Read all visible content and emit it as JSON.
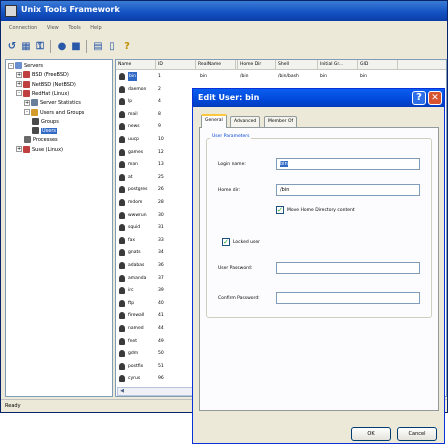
{
  "window": {
    "title": "Unix Tools Framework"
  },
  "menu": [
    "Connection",
    "View",
    "Tools",
    "Help"
  ],
  "tree": [
    {
      "label": "Servers",
      "indent": 0,
      "exp": "-",
      "color": "#6a8fd0"
    },
    {
      "label": "BSD (FreeBSD)",
      "indent": 1,
      "exp": "+",
      "color": "#c04040"
    },
    {
      "label": "NetBSD (NetBSD)",
      "indent": 1,
      "exp": "+",
      "color": "#c04040"
    },
    {
      "label": "RedHat (Linux)",
      "indent": 1,
      "exp": "-",
      "color": "#c04040"
    },
    {
      "label": "Server Statistics",
      "indent": 2,
      "exp": "+",
      "color": "#6a7f99"
    },
    {
      "label": "Users and Groups",
      "indent": 2,
      "exp": "-",
      "color": "#d59b2a"
    },
    {
      "label": "Groups",
      "indent": 3,
      "exp": "",
      "color": "#4a4a4a"
    },
    {
      "label": "Users",
      "indent": 3,
      "exp": "",
      "color": "#4a4a4a",
      "selected": true
    },
    {
      "label": "Processes",
      "indent": 2,
      "exp": "",
      "color": "#6a6a6a"
    },
    {
      "label": "Suse (Linux)",
      "indent": 1,
      "exp": "+",
      "color": "#c04040"
    }
  ],
  "columns": [
    "Name",
    "ID",
    "",
    "RealName",
    "Home Dir",
    "Shell",
    "Initial Gr...",
    "GID"
  ],
  "first_row": {
    "name": "bin",
    "id": "1",
    "realname": "bin",
    "home": "/bin",
    "shell": "/bin/bash",
    "group": "bin",
    "gid": "bin"
  },
  "users": [
    [
      "bin",
      "1"
    ],
    [
      "daemon",
      "2"
    ],
    [
      "lp",
      "4"
    ],
    [
      "mail",
      "8"
    ],
    [
      "news",
      "9"
    ],
    [
      "uucp",
      "10"
    ],
    [
      "games",
      "12"
    ],
    [
      "man",
      "13"
    ],
    [
      "at",
      "25"
    ],
    [
      "postgres",
      "26"
    ],
    [
      "mdom",
      "28"
    ],
    [
      "wwwrun",
      "30"
    ],
    [
      "squid",
      "31"
    ],
    [
      "fax",
      "33"
    ],
    [
      "gnats",
      "34"
    ],
    [
      "adabas",
      "36"
    ],
    [
      "amanda",
      "37"
    ],
    [
      "irc",
      "39"
    ],
    [
      "ftp",
      "40"
    ],
    [
      "firewall",
      "41"
    ],
    [
      "named",
      "44"
    ],
    [
      "fnet",
      "49"
    ],
    [
      "gdm",
      "50"
    ],
    [
      "postfix",
      "51"
    ],
    [
      "cyrus",
      "96"
    ]
  ],
  "status": "Ready",
  "dialog": {
    "title": "Edit User: bin",
    "tabs": [
      "General",
      "Advanced",
      "Member Of"
    ],
    "group_label": "User Parameters",
    "login_label": "Login name:",
    "login_value": "bin",
    "home_label": "Home dir:",
    "home_value": "/bin",
    "move_home_label": "Move Home Directory content",
    "locked_label": "Locked user",
    "password_label": "User Password:",
    "confirm_label": "Confirm Password:",
    "ok_label": "OK",
    "cancel_label": "Cancel"
  }
}
